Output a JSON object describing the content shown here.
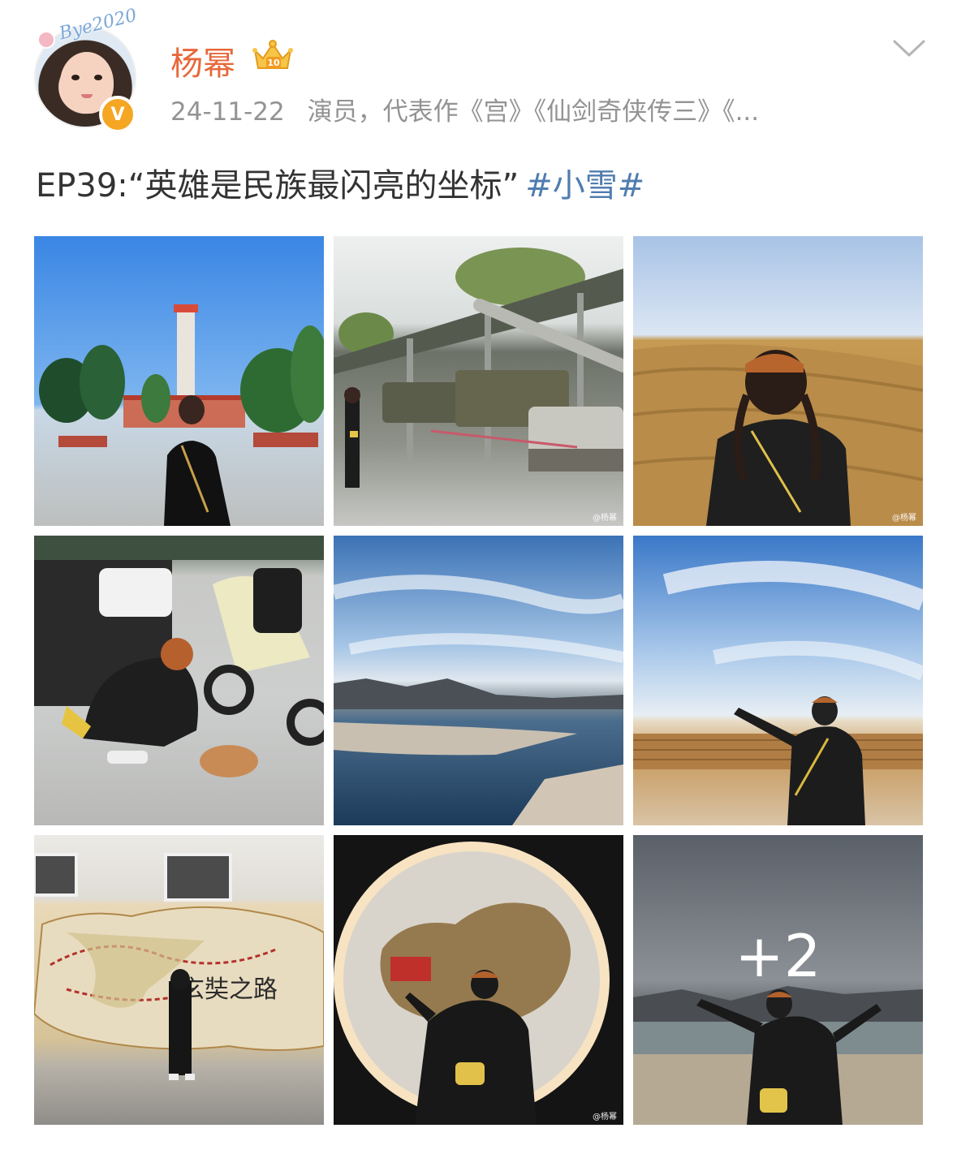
{
  "post": {
    "author": {
      "name": "杨幂",
      "avatar_tag": "Bye2020",
      "verified_mark": "V"
    },
    "meta": {
      "time": "24-11-22",
      "source": "演员，代表作《宫》《仙剑奇侠传三》《..."
    },
    "text": {
      "body": "EP39:“英雄是民族最闪亮的坐标”",
      "topic": "#小雪#"
    },
    "images": [
      {
        "watermark": "",
        "overlay": ""
      },
      {
        "watermark": "@杨幂",
        "overlay": ""
      },
      {
        "watermark": "@杨幂",
        "overlay": ""
      },
      {
        "watermark": "",
        "overlay": ""
      },
      {
        "watermark": "",
        "overlay": ""
      },
      {
        "watermark": "",
        "overlay": ""
      },
      {
        "watermark": "",
        "overlay": ""
      },
      {
        "watermark": "@杨幂",
        "overlay": ""
      },
      {
        "watermark": "",
        "overlay": "+2"
      }
    ],
    "image_7_sign": "玄奘之路",
    "icons": {
      "expand": "chevron-down-icon",
      "member": "crown-badge-icon"
    }
  },
  "colors": {
    "username": "#e7683a",
    "topic": "#507daf",
    "meta": "#939393",
    "verified": "#f5a623"
  }
}
